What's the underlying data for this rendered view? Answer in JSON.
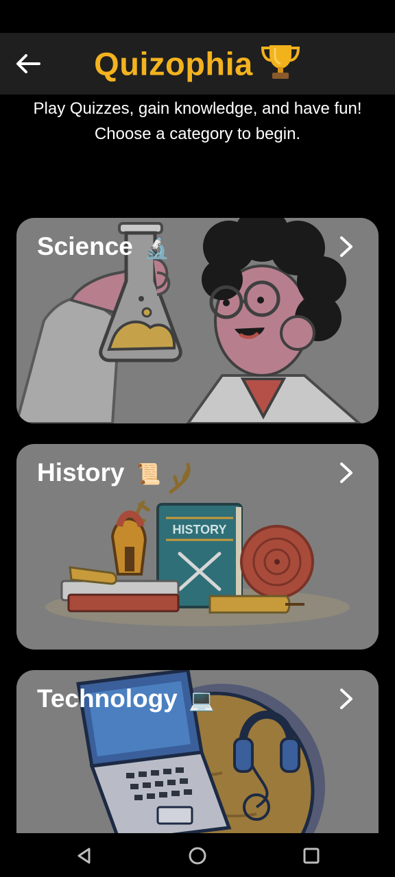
{
  "header": {
    "title": "Quizophia",
    "trophy": "🏆"
  },
  "intro": {
    "line1": "Play Quizzes, gain knowledge, and have fun!",
    "line2": "Choose a category to begin."
  },
  "categories": [
    {
      "label": "Science",
      "emoji": "🔬"
    },
    {
      "label": "History",
      "emoji": "📜"
    },
    {
      "label": "Technology",
      "emoji": "💻"
    }
  ],
  "history_book": {
    "title": "HISTORY"
  },
  "colors": {
    "accent": "#f3b21f",
    "appbar": "#1f1f1f",
    "card": "#7e7e7e"
  }
}
